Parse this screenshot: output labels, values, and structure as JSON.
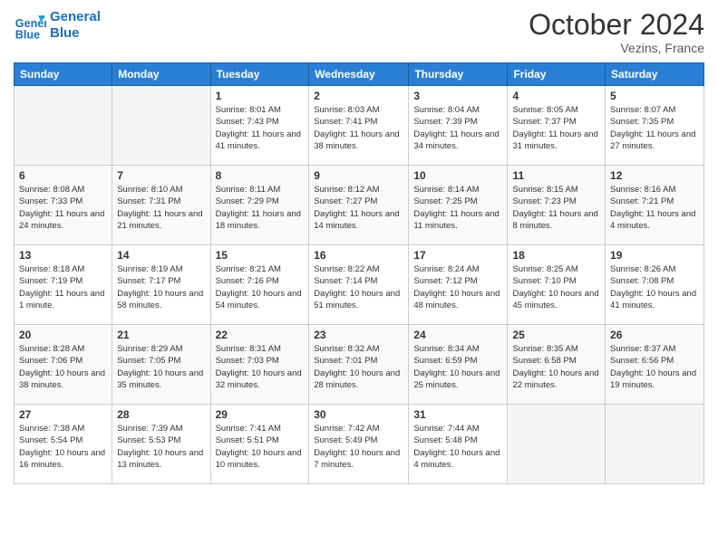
{
  "header": {
    "logo_line1": "General",
    "logo_line2": "Blue",
    "month_title": "October 2024",
    "location": "Vezins, France"
  },
  "weekdays": [
    "Sunday",
    "Monday",
    "Tuesday",
    "Wednesday",
    "Thursday",
    "Friday",
    "Saturday"
  ],
  "weeks": [
    [
      {
        "day": "",
        "sunrise": "",
        "sunset": "",
        "daylight": ""
      },
      {
        "day": "",
        "sunrise": "",
        "sunset": "",
        "daylight": ""
      },
      {
        "day": "1",
        "sunrise": "Sunrise: 8:01 AM",
        "sunset": "Sunset: 7:43 PM",
        "daylight": "Daylight: 11 hours and 41 minutes."
      },
      {
        "day": "2",
        "sunrise": "Sunrise: 8:03 AM",
        "sunset": "Sunset: 7:41 PM",
        "daylight": "Daylight: 11 hours and 38 minutes."
      },
      {
        "day": "3",
        "sunrise": "Sunrise: 8:04 AM",
        "sunset": "Sunset: 7:39 PM",
        "daylight": "Daylight: 11 hours and 34 minutes."
      },
      {
        "day": "4",
        "sunrise": "Sunrise: 8:05 AM",
        "sunset": "Sunset: 7:37 PM",
        "daylight": "Daylight: 11 hours and 31 minutes."
      },
      {
        "day": "5",
        "sunrise": "Sunrise: 8:07 AM",
        "sunset": "Sunset: 7:35 PM",
        "daylight": "Daylight: 11 hours and 27 minutes."
      }
    ],
    [
      {
        "day": "6",
        "sunrise": "Sunrise: 8:08 AM",
        "sunset": "Sunset: 7:33 PM",
        "daylight": "Daylight: 11 hours and 24 minutes."
      },
      {
        "day": "7",
        "sunrise": "Sunrise: 8:10 AM",
        "sunset": "Sunset: 7:31 PM",
        "daylight": "Daylight: 11 hours and 21 minutes."
      },
      {
        "day": "8",
        "sunrise": "Sunrise: 8:11 AM",
        "sunset": "Sunset: 7:29 PM",
        "daylight": "Daylight: 11 hours and 18 minutes."
      },
      {
        "day": "9",
        "sunrise": "Sunrise: 8:12 AM",
        "sunset": "Sunset: 7:27 PM",
        "daylight": "Daylight: 11 hours and 14 minutes."
      },
      {
        "day": "10",
        "sunrise": "Sunrise: 8:14 AM",
        "sunset": "Sunset: 7:25 PM",
        "daylight": "Daylight: 11 hours and 11 minutes."
      },
      {
        "day": "11",
        "sunrise": "Sunrise: 8:15 AM",
        "sunset": "Sunset: 7:23 PM",
        "daylight": "Daylight: 11 hours and 8 minutes."
      },
      {
        "day": "12",
        "sunrise": "Sunrise: 8:16 AM",
        "sunset": "Sunset: 7:21 PM",
        "daylight": "Daylight: 11 hours and 4 minutes."
      }
    ],
    [
      {
        "day": "13",
        "sunrise": "Sunrise: 8:18 AM",
        "sunset": "Sunset: 7:19 PM",
        "daylight": "Daylight: 11 hours and 1 minute."
      },
      {
        "day": "14",
        "sunrise": "Sunrise: 8:19 AM",
        "sunset": "Sunset: 7:17 PM",
        "daylight": "Daylight: 10 hours and 58 minutes."
      },
      {
        "day": "15",
        "sunrise": "Sunrise: 8:21 AM",
        "sunset": "Sunset: 7:16 PM",
        "daylight": "Daylight: 10 hours and 54 minutes."
      },
      {
        "day": "16",
        "sunrise": "Sunrise: 8:22 AM",
        "sunset": "Sunset: 7:14 PM",
        "daylight": "Daylight: 10 hours and 51 minutes."
      },
      {
        "day": "17",
        "sunrise": "Sunrise: 8:24 AM",
        "sunset": "Sunset: 7:12 PM",
        "daylight": "Daylight: 10 hours and 48 minutes."
      },
      {
        "day": "18",
        "sunrise": "Sunrise: 8:25 AM",
        "sunset": "Sunset: 7:10 PM",
        "daylight": "Daylight: 10 hours and 45 minutes."
      },
      {
        "day": "19",
        "sunrise": "Sunrise: 8:26 AM",
        "sunset": "Sunset: 7:08 PM",
        "daylight": "Daylight: 10 hours and 41 minutes."
      }
    ],
    [
      {
        "day": "20",
        "sunrise": "Sunrise: 8:28 AM",
        "sunset": "Sunset: 7:06 PM",
        "daylight": "Daylight: 10 hours and 38 minutes."
      },
      {
        "day": "21",
        "sunrise": "Sunrise: 8:29 AM",
        "sunset": "Sunset: 7:05 PM",
        "daylight": "Daylight: 10 hours and 35 minutes."
      },
      {
        "day": "22",
        "sunrise": "Sunrise: 8:31 AM",
        "sunset": "Sunset: 7:03 PM",
        "daylight": "Daylight: 10 hours and 32 minutes."
      },
      {
        "day": "23",
        "sunrise": "Sunrise: 8:32 AM",
        "sunset": "Sunset: 7:01 PM",
        "daylight": "Daylight: 10 hours and 28 minutes."
      },
      {
        "day": "24",
        "sunrise": "Sunrise: 8:34 AM",
        "sunset": "Sunset: 6:59 PM",
        "daylight": "Daylight: 10 hours and 25 minutes."
      },
      {
        "day": "25",
        "sunrise": "Sunrise: 8:35 AM",
        "sunset": "Sunset: 6:58 PM",
        "daylight": "Daylight: 10 hours and 22 minutes."
      },
      {
        "day": "26",
        "sunrise": "Sunrise: 8:37 AM",
        "sunset": "Sunset: 6:56 PM",
        "daylight": "Daylight: 10 hours and 19 minutes."
      }
    ],
    [
      {
        "day": "27",
        "sunrise": "Sunrise: 7:38 AM",
        "sunset": "Sunset: 5:54 PM",
        "daylight": "Daylight: 10 hours and 16 minutes."
      },
      {
        "day": "28",
        "sunrise": "Sunrise: 7:39 AM",
        "sunset": "Sunset: 5:53 PM",
        "daylight": "Daylight: 10 hours and 13 minutes."
      },
      {
        "day": "29",
        "sunrise": "Sunrise: 7:41 AM",
        "sunset": "Sunset: 5:51 PM",
        "daylight": "Daylight: 10 hours and 10 minutes."
      },
      {
        "day": "30",
        "sunrise": "Sunrise: 7:42 AM",
        "sunset": "Sunset: 5:49 PM",
        "daylight": "Daylight: 10 hours and 7 minutes."
      },
      {
        "day": "31",
        "sunrise": "Sunrise: 7:44 AM",
        "sunset": "Sunset: 5:48 PM",
        "daylight": "Daylight: 10 hours and 4 minutes."
      },
      {
        "day": "",
        "sunrise": "",
        "sunset": "",
        "daylight": ""
      },
      {
        "day": "",
        "sunrise": "",
        "sunset": "",
        "daylight": ""
      }
    ]
  ]
}
